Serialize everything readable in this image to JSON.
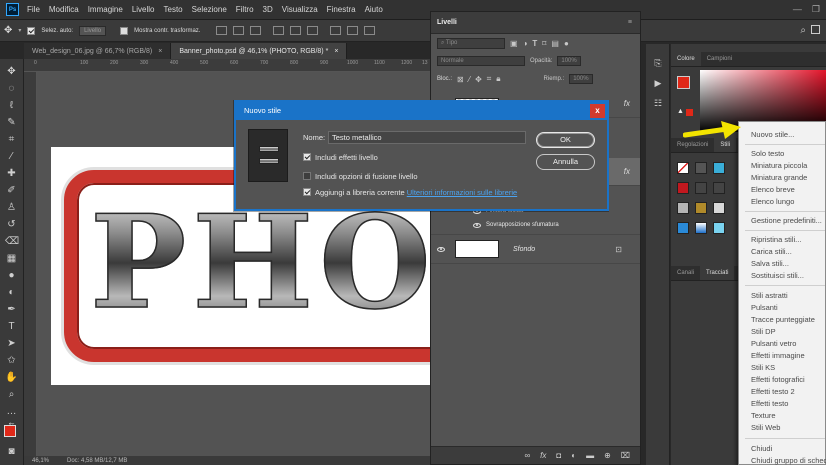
{
  "menubar": {
    "logo": "Ps",
    "items": [
      "File",
      "Modifica",
      "Immagine",
      "Livello",
      "Testo",
      "Selezione",
      "Filtro",
      "3D",
      "Visualizza",
      "Finestra",
      "Aiuto"
    ]
  },
  "options": {
    "autoselect_label": "Selez. auto:",
    "autoselect_value": "Livello",
    "transform_label": "Mostra contr. trasformaz."
  },
  "tabs": [
    {
      "label": "Web_design_06.jpg @ 66,7% (RGB/8)",
      "close": "×"
    },
    {
      "label": "Banner_photo.psd @ 46,1% (PHOTO, RGB/8) *",
      "close": "×"
    }
  ],
  "ruler": [
    "0",
    "100",
    "200",
    "300",
    "400",
    "500",
    "600",
    "700",
    "800",
    "900",
    "1000",
    "1100",
    "1200",
    "13"
  ],
  "canvas": {
    "text": "PHOT"
  },
  "status": {
    "zoom": "46,1%",
    "doc": "Doc: 4,58 MB/12,7 MB"
  },
  "layers": {
    "title": "Livelli",
    "filter": "Tipo",
    "blend": "Normale",
    "opacity_label": "Opacità:",
    "opacity_value": "100%",
    "lock_label": "Bloc.:",
    "fill_label": "Riemp.:",
    "fill_value": "100%",
    "effects": [
      "Finitura lucida",
      "Sovrapposizione sfumatura"
    ],
    "background_layer": "Sfondo",
    "fx": "fx"
  },
  "right_panel": {
    "top_tabs": [
      "Colore",
      "Campioni"
    ],
    "mid_tabs": [
      "Regolazioni",
      "Stili"
    ],
    "bottom_tabs": [
      "Canali",
      "Tracciati"
    ]
  },
  "flyout": {
    "items": [
      "Nuovo stile...",
      "Solo testo",
      "Miniatura piccola",
      "Miniatura grande",
      "Elenco breve",
      "Elenco lungo",
      "Gestione predefiniti...",
      "Ripristina stili...",
      "Carica stili...",
      "Salva stili...",
      "Sostituisci stili...",
      "Stili astratti",
      "Pulsanti",
      "Tracce punteggiate",
      "Stili DP",
      "Pulsanti vetro",
      "Effetti immagine",
      "Stili KS",
      "Effetti fotografici",
      "Effetti testo 2",
      "Effetti testo",
      "Texture",
      "Stili Web",
      "Chiudi",
      "Chiudi gruppo di schede"
    ]
  },
  "dialog": {
    "title": "Nuovo stile",
    "close": "x",
    "name_label": "Nome:",
    "name_value": "Testo metallico",
    "include_effects": "Includi effetti livello",
    "include_effects_checked": true,
    "include_blend": "Includi opzioni di fusione livello",
    "include_blend_checked": false,
    "add_library": "Aggiungi a libreria corrente",
    "add_library_checked": true,
    "library_link": "Ulteriori informazioni sulle librerie",
    "ok": "OK",
    "cancel": "Annulla"
  },
  "colors": {
    "accent": "#1a73c8",
    "foreground": "#e02818",
    "arrow": "#f3e400",
    "frame_red": "#c9352e"
  }
}
